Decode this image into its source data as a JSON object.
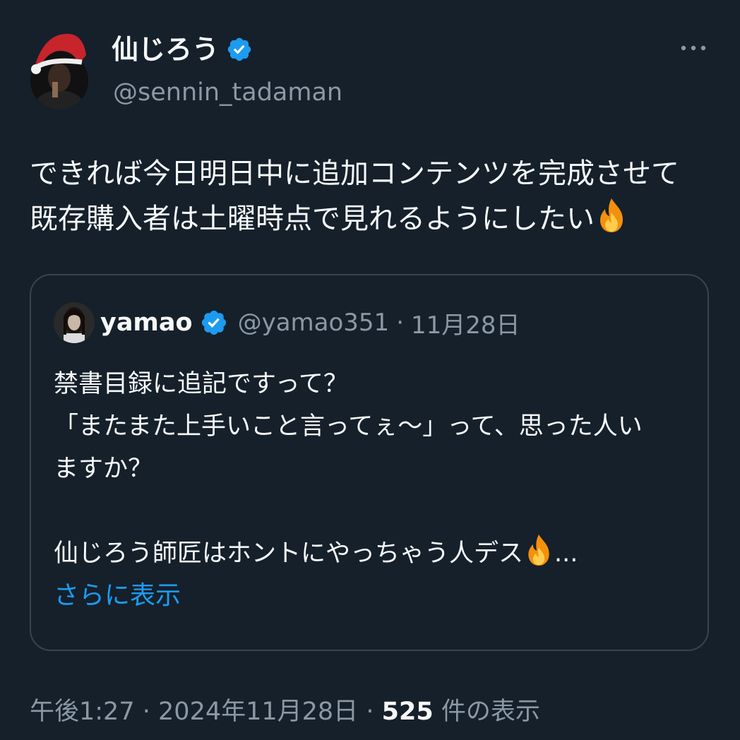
{
  "author": {
    "display_name": "仙じろう",
    "handle": "@sennin_tadaman",
    "verified": true,
    "avatar": "avatar-santa-hat"
  },
  "more_icon": "more-horizontal-icon",
  "tweet": {
    "lines": [
      "できれば今日明日中に追加コンテンツを完成させて",
      "既存購入者は土曜時点で見れるようにしたい"
    ],
    "trailing_emoji": "fire-emoji"
  },
  "quoted": {
    "display_name": "yamao",
    "handle": "@yamao351",
    "separator": "·",
    "date": "11月28日",
    "verified": true,
    "lines": [
      "禁書目録に追記ですって？",
      "「またまた上手いこと言ってぇ～」って、思った人い",
      "ますか？",
      "",
      "仙じろう師匠はホントにやっちゃう人デス"
    ],
    "ellipsis": "...",
    "show_more": "さらに表示"
  },
  "footer": {
    "time": "午後1:27",
    "separator": "·",
    "date": "2024年11月28日",
    "views_count": "525",
    "views_label": "件の表示"
  },
  "colors": {
    "background": "#15202b",
    "text": "#f7f9f9",
    "secondary": "#8b98a5",
    "border": "#38444d",
    "link": "#1d9bf0",
    "verified": "#1d9bf0"
  }
}
